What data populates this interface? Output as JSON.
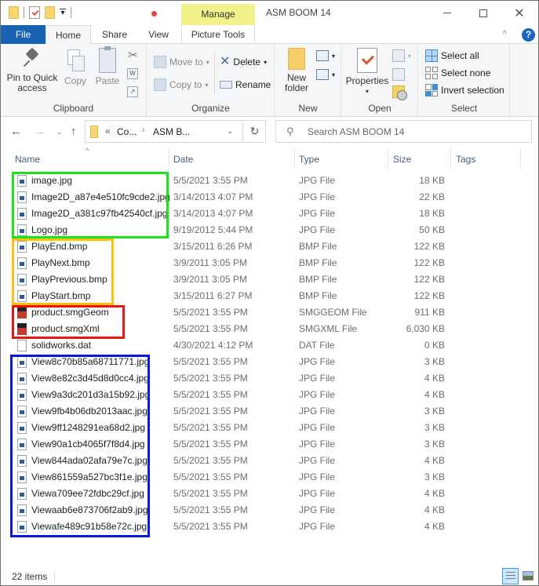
{
  "window": {
    "title": "ASM BOOM 14",
    "context_tab": "Manage",
    "controls": [
      "minimize",
      "maximize",
      "close"
    ]
  },
  "ribbon_tabs": [
    "File",
    "Home",
    "Share",
    "View",
    "Picture Tools"
  ],
  "ribbon": {
    "clipboard": {
      "label": "Clipboard",
      "pin_label": "Pin to Quick access",
      "pin_line1": "Pin to Quick",
      "pin_line2": "access",
      "copy": "Copy",
      "paste": "Paste"
    },
    "organize": {
      "label": "Organize",
      "move_to": "Move to",
      "copy_to": "Copy to",
      "delete": "Delete",
      "rename": "Rename"
    },
    "new": {
      "label": "New",
      "new_folder_line1": "New",
      "new_folder_line2": "folder"
    },
    "open": {
      "label": "Open",
      "properties": "Properties"
    },
    "select": {
      "label": "Select",
      "select_all": "Select all",
      "select_none": "Select none",
      "invert_selection": "Invert selection"
    }
  },
  "address": {
    "overflow": "«",
    "crumbs": [
      "Co...",
      "ASM B..."
    ],
    "search_placeholder": "Search ASM BOOM 14"
  },
  "columns": [
    "Name",
    "Date",
    "Type",
    "Size",
    "Tags"
  ],
  "files": [
    {
      "name": "image.jpg",
      "date": "5/5/2021 3:55 PM",
      "type": "JPG File",
      "size": "18 KB",
      "icon": "image"
    },
    {
      "name": "Image2D_a87e4e510fc9cde2.jpg",
      "date": "3/14/2013 4:07 PM",
      "type": "JPG File",
      "size": "22 KB",
      "icon": "image"
    },
    {
      "name": "Image2D_a381c97fb42540cf.jpg",
      "date": "3/14/2013 4:07 PM",
      "type": "JPG File",
      "size": "18 KB",
      "icon": "image"
    },
    {
      "name": "Logo.jpg",
      "date": "9/19/2012 5:44 PM",
      "type": "JPG File",
      "size": "50 KB",
      "icon": "image"
    },
    {
      "name": "PlayEnd.bmp",
      "date": "3/15/2011 6:26 PM",
      "type": "BMP File",
      "size": "122 KB",
      "icon": "image"
    },
    {
      "name": "PlayNext.bmp",
      "date": "3/9/2011 3:05 PM",
      "type": "BMP File",
      "size": "122 KB",
      "icon": "image"
    },
    {
      "name": "PlayPrevious.bmp",
      "date": "3/9/2011 3:05 PM",
      "type": "BMP File",
      "size": "122 KB",
      "icon": "image"
    },
    {
      "name": "PlayStart.bmp",
      "date": "3/15/2011 6:27 PM",
      "type": "BMP File",
      "size": "122 KB",
      "icon": "image"
    },
    {
      "name": "product.smgGeom",
      "date": "5/5/2021 3:55 PM",
      "type": "SMGGEOM File",
      "size": "911 KB",
      "icon": "solidworks"
    },
    {
      "name": "product.smgXml",
      "date": "5/5/2021 3:55 PM",
      "type": "SMGXML File",
      "size": "6,030 KB",
      "icon": "solidworks"
    },
    {
      "name": "solidworks.dat",
      "date": "4/30/2021 4:12 PM",
      "type": "DAT File",
      "size": "0 KB",
      "icon": "blank"
    },
    {
      "name": "View8c70b85a68711771.jpg",
      "date": "5/5/2021 3:55 PM",
      "type": "JPG File",
      "size": "3 KB",
      "icon": "image"
    },
    {
      "name": "View8e82c3d45d8d0cc4.jpg",
      "date": "5/5/2021 3:55 PM",
      "type": "JPG File",
      "size": "4 KB",
      "icon": "image"
    },
    {
      "name": "View9a3dc201d3a15b92.jpg",
      "date": "5/5/2021 3:55 PM",
      "type": "JPG File",
      "size": "4 KB",
      "icon": "image"
    },
    {
      "name": "View9fb4b06db2013aac.jpg",
      "date": "5/5/2021 3:55 PM",
      "type": "JPG File",
      "size": "3 KB",
      "icon": "image"
    },
    {
      "name": "View9ff1248291ea68d2.jpg",
      "date": "5/5/2021 3:55 PM",
      "type": "JPG File",
      "size": "3 KB",
      "icon": "image"
    },
    {
      "name": "View90a1cb4065f7f8d4.jpg",
      "date": "5/5/2021 3:55 PM",
      "type": "JPG File",
      "size": "3 KB",
      "icon": "image"
    },
    {
      "name": "View844ada02afa79e7c.jpg",
      "date": "5/5/2021 3:55 PM",
      "type": "JPG File",
      "size": "4 KB",
      "icon": "image"
    },
    {
      "name": "View861559a527bc3f1e.jpg",
      "date": "5/5/2021 3:55 PM",
      "type": "JPG File",
      "size": "3 KB",
      "icon": "image"
    },
    {
      "name": "Viewa709ee72fdbc29cf.jpg",
      "date": "5/5/2021 3:55 PM",
      "type": "JPG File",
      "size": "4 KB",
      "icon": "image"
    },
    {
      "name": "Viewaab6e873706f2ab9.jpg",
      "date": "5/5/2021 3:55 PM",
      "type": "JPG File",
      "size": "4 KB",
      "icon": "image"
    },
    {
      "name": "Viewafe489c91b58e72c.jpg",
      "date": "5/5/2021 3:55 PM",
      "type": "JPG File",
      "size": "4 KB",
      "icon": "image"
    }
  ],
  "annotations": [
    {
      "color": "#19e619",
      "label": "green-group"
    },
    {
      "color": "#ffc107",
      "label": "yellow-group"
    },
    {
      "color": "#e81515",
      "label": "red-group"
    },
    {
      "color": "#0b16e0",
      "label": "blue-group"
    }
  ],
  "status": {
    "item_count": "22 items"
  }
}
